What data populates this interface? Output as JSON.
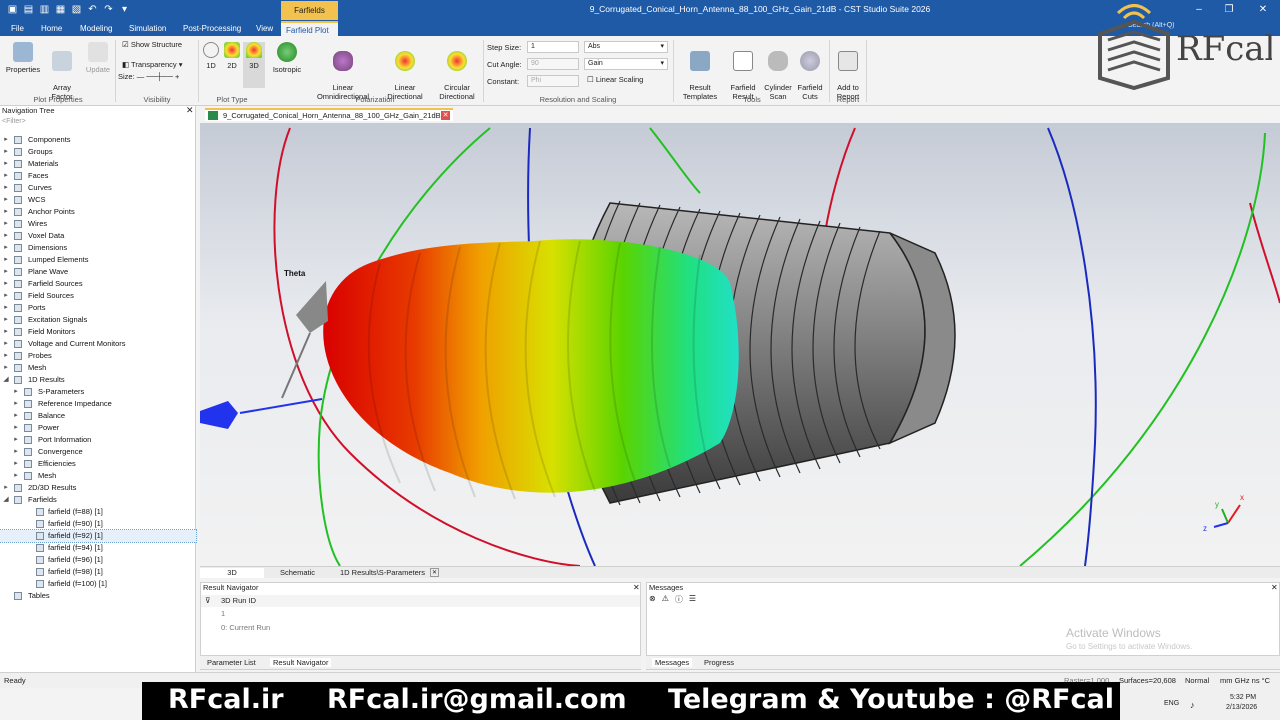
{
  "titlebar": {
    "title": "9_Corrugated_Conical_Horn_Antenna_88_100_GHz_Gain_21dB - CST Studio Suite 2026",
    "context_tab": "Farfields",
    "search_placeholder": "Search (Alt+Q)"
  },
  "menu": {
    "tabs": [
      "File",
      "Home",
      "Modeling",
      "Simulation",
      "Post-Processing",
      "View",
      "Farfield Plot"
    ],
    "active": "Farfield Plot"
  },
  "ribbon": {
    "properties": "Properties",
    "array_factor": "Array\nFactor",
    "update": "Update",
    "show_structure": "Show Structure",
    "transparency": "Transparency",
    "size_label": "Size:",
    "plot_type_1d": "1D",
    "plot_type_2d": "2D",
    "plot_type_3d": "3D",
    "isotropic": "Isotropic",
    "linear_omni": "Linear\nOmnidirectional",
    "linear_dir": "Linear\nDirectional",
    "circular_dir": "Circular\nDirectional",
    "step_size_label": "Step Size:",
    "step_size_value": "1",
    "step_size_select": "Abs",
    "cut_angle_label": "Cut Angle:",
    "cut_angle_value": "90",
    "cut_angle_select": "Gain",
    "constant_label": "Constant:",
    "constant_value": "Phi",
    "linear_scaling": "Linear Scaling",
    "result_templates": "Result\nTemplates",
    "farfield_result": "Farfield\nResult",
    "cylinder_scan": "Cylinder\nScan",
    "farfield_cuts": "Farfield\nCuts",
    "add_to_report": "Add to\nReport",
    "groups": {
      "plot_properties": "Plot Properties",
      "visibility": "Visibility",
      "plot_type": "Plot Type",
      "polarization": "Polarization",
      "resolution": "Resolution and Scaling",
      "tools": "Tools",
      "report": "Report"
    }
  },
  "nav": {
    "title": "Navigation Tree",
    "filter": "<Filter>",
    "items": [
      {
        "label": "Components",
        "level": 0
      },
      {
        "label": "Groups",
        "level": 0
      },
      {
        "label": "Materials",
        "level": 0
      },
      {
        "label": "Faces",
        "level": 0
      },
      {
        "label": "Curves",
        "level": 0
      },
      {
        "label": "WCS",
        "level": 0
      },
      {
        "label": "Anchor Points",
        "level": 0
      },
      {
        "label": "Wires",
        "level": 0
      },
      {
        "label": "Voxel Data",
        "level": 0
      },
      {
        "label": "Dimensions",
        "level": 0
      },
      {
        "label": "Lumped Elements",
        "level": 0
      },
      {
        "label": "Plane Wave",
        "level": 0
      },
      {
        "label": "Farfield Sources",
        "level": 0
      },
      {
        "label": "Field Sources",
        "level": 0
      },
      {
        "label": "Ports",
        "level": 0
      },
      {
        "label": "Excitation Signals",
        "level": 0
      },
      {
        "label": "Field Monitors",
        "level": 0
      },
      {
        "label": "Voltage and Current Monitors",
        "level": 0
      },
      {
        "label": "Probes",
        "level": 0
      },
      {
        "label": "Mesh",
        "level": 0
      },
      {
        "label": "1D Results",
        "level": 0,
        "open": true
      },
      {
        "label": "S-Parameters",
        "level": 1
      },
      {
        "label": "Reference Impedance",
        "level": 1
      },
      {
        "label": "Balance",
        "level": 1
      },
      {
        "label": "Power",
        "level": 1
      },
      {
        "label": "Port Information",
        "level": 1
      },
      {
        "label": "Convergence",
        "level": 1
      },
      {
        "label": "Efficiencies",
        "level": 1
      },
      {
        "label": "Mesh",
        "level": 1
      },
      {
        "label": "2D/3D Results",
        "level": 0
      },
      {
        "label": "Farfields",
        "level": 0,
        "open": true
      },
      {
        "label": "farfield (f=88) [1]",
        "level": 1,
        "leaf": true
      },
      {
        "label": "farfield (f=90) [1]",
        "level": 1,
        "leaf": true
      },
      {
        "label": "farfield (f=92) [1]",
        "level": 1,
        "leaf": true,
        "selected": true
      },
      {
        "label": "farfield (f=94) [1]",
        "level": 1,
        "leaf": true
      },
      {
        "label": "farfield (f=96) [1]",
        "level": 1,
        "leaf": true
      },
      {
        "label": "farfield (f=98) [1]",
        "level": 1,
        "leaf": true
      },
      {
        "label": "farfield (f=100) [1]",
        "level": 1,
        "leaf": true
      },
      {
        "label": "Tables",
        "level": 0,
        "noarrow": true
      }
    ]
  },
  "doc_tab": "9_Corrugated_Conical_Horn_Antenna_88_100_GHz_Gain_21dB",
  "viewport": {
    "theta_label": "Theta",
    "axis_x": "x",
    "axis_y": "y",
    "axis_z": "z"
  },
  "bottom_tabs": [
    "3D",
    "Schematic",
    "1D Results\\S-Parameters"
  ],
  "result_navigator": {
    "title": "Result Navigator",
    "col": "3D Run ID",
    "row1": "1",
    "row2": "0: Current Run"
  },
  "messages": {
    "title": "Messages"
  },
  "left_bottom_tabs": [
    "Parameter List",
    "Result Navigator"
  ],
  "right_bottom_tabs": [
    "Messages",
    "Progress"
  ],
  "activate": {
    "line1": "Activate Windows",
    "line2": "Go to Settings to activate Windows."
  },
  "status": {
    "ready": "Ready",
    "raster": "Raster=1.000",
    "surfaces": "Surfaces=20,608",
    "normal": "Normal",
    "units": "mm  GHz  ns  °C"
  },
  "banner": {
    "site": "RFcal.ir",
    "email": "RFcal.ir@gmail.com",
    "social": "Telegram & Youtube : @RFcal"
  },
  "logo_text": "RFcal",
  "taskbar": {
    "lang": "ENG",
    "time": "5:32 PM",
    "date": "2/13/2026"
  },
  "colors": {
    "accent": "#1f5aa6",
    "context": "#f2c14e"
  }
}
